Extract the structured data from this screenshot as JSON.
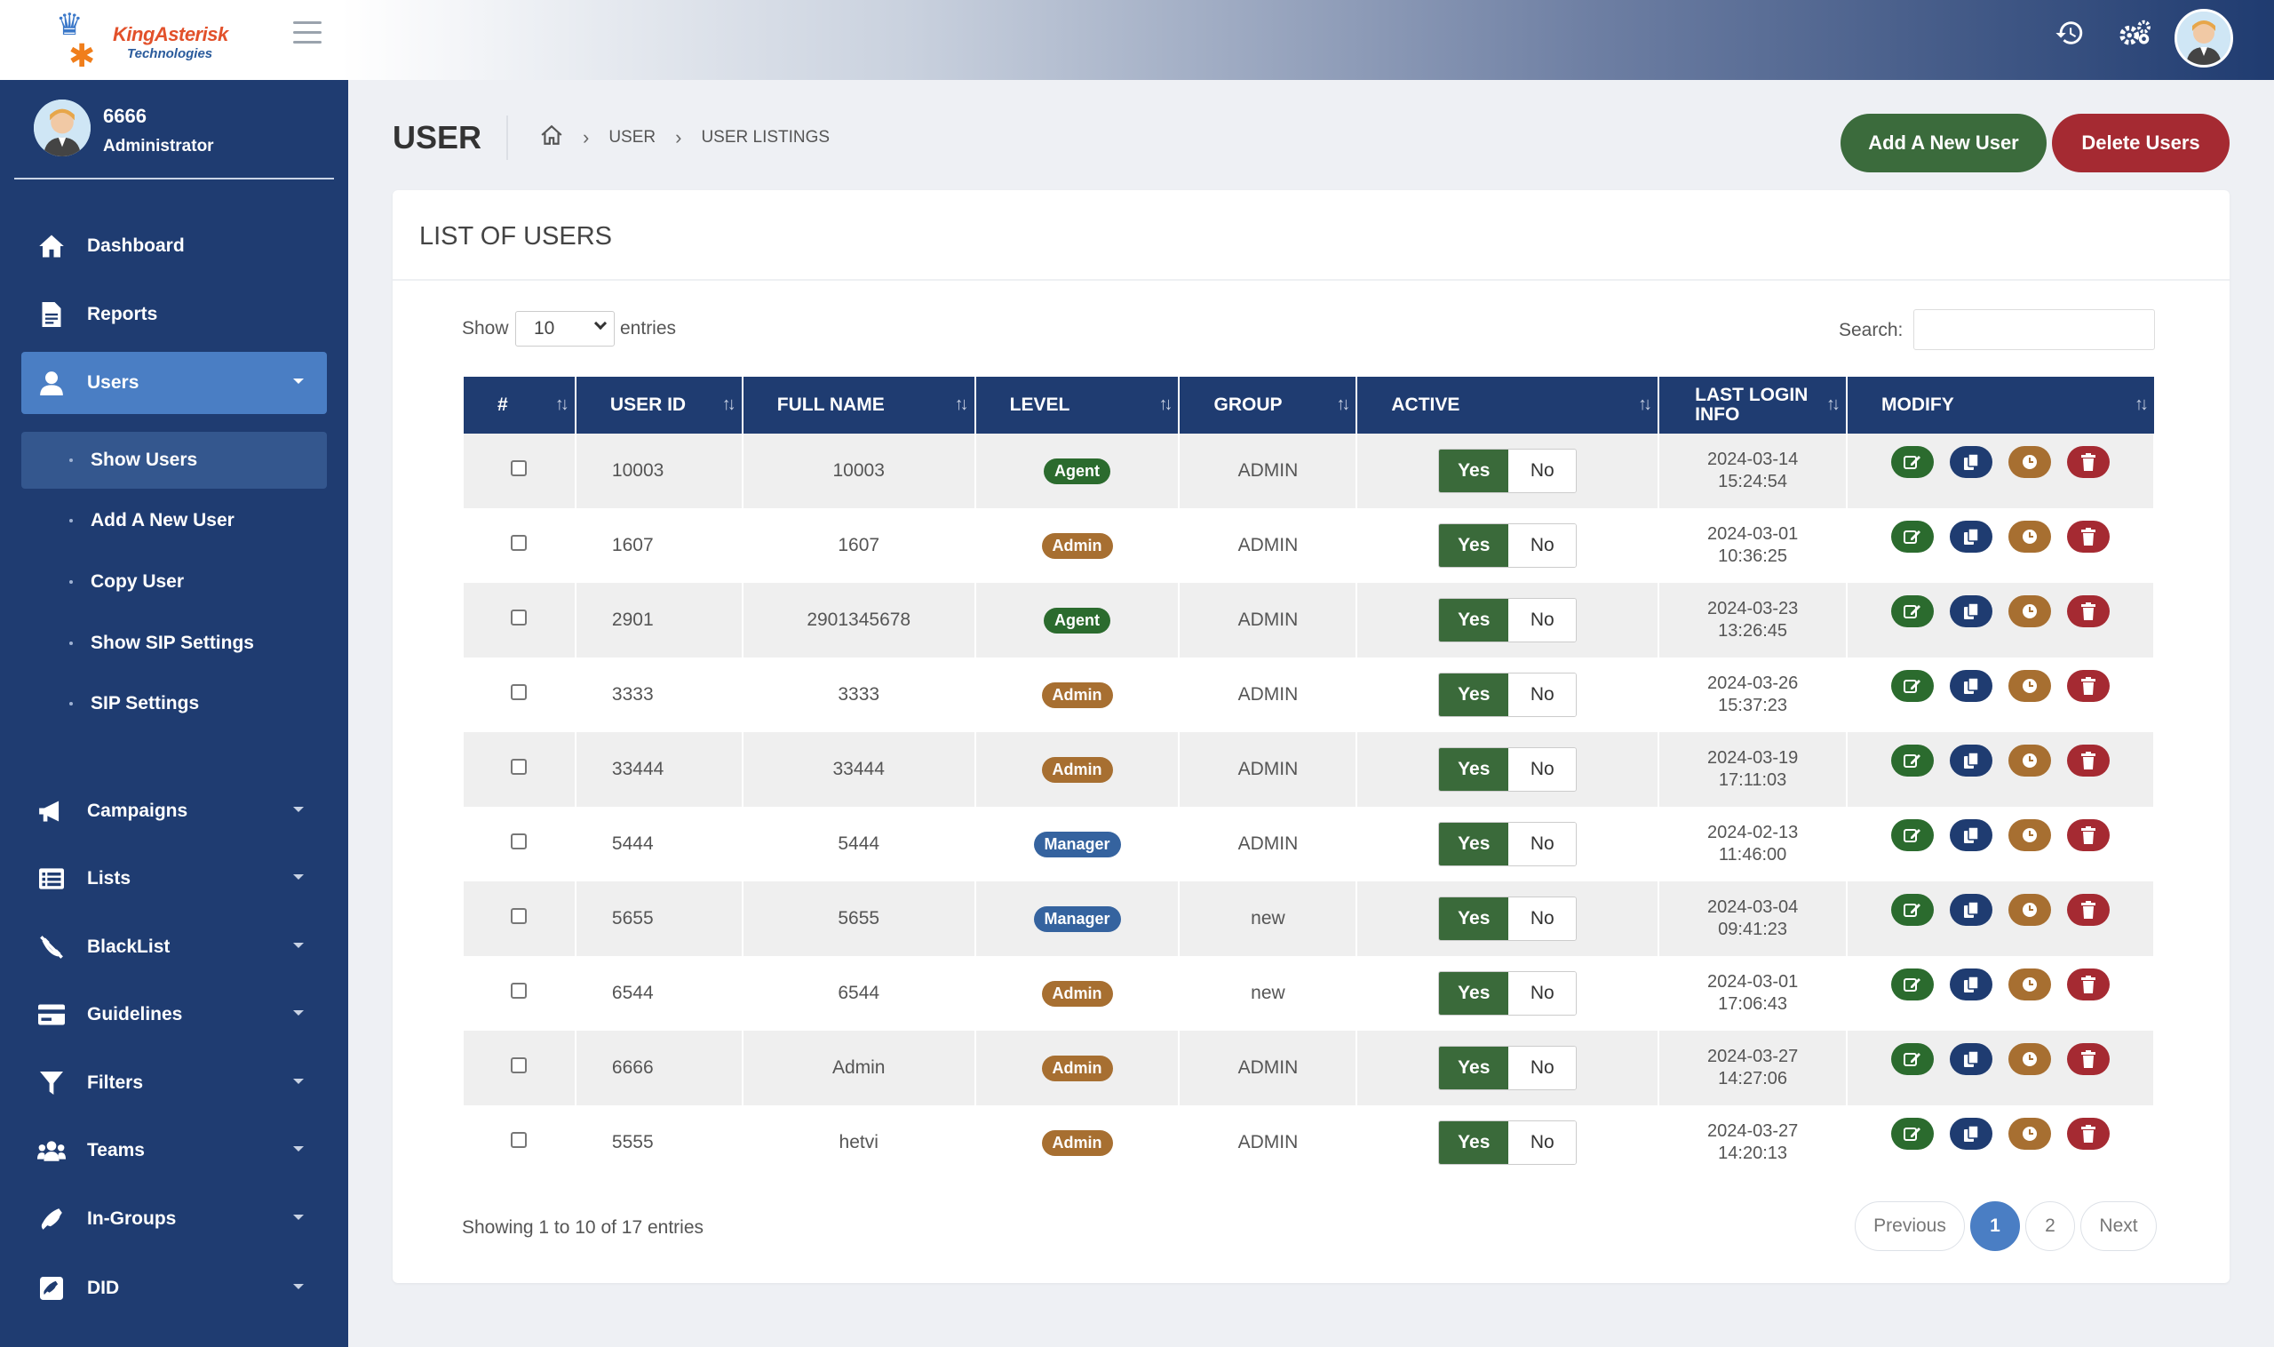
{
  "brand": {
    "name": "KingAsterisk",
    "sub": "Technologies"
  },
  "profile": {
    "name": "6666",
    "role": "Administrator"
  },
  "nav": {
    "dashboard": "Dashboard",
    "reports": "Reports",
    "users": "Users",
    "campaigns": "Campaigns",
    "lists": "Lists",
    "blacklist": "BlackList",
    "guidelines": "Guidelines",
    "filters": "Filters",
    "teams": "Teams",
    "ingroups": "In-Groups",
    "did": "DID"
  },
  "subnav": {
    "show_users": "Show Users",
    "add_user": "Add A New User",
    "copy_user": "Copy User",
    "show_sip": "Show SIP Settings",
    "sip_settings": "SIP Settings"
  },
  "header": {
    "title": "USER",
    "crumb1": "USER",
    "crumb2": "USER LISTINGS"
  },
  "buttons": {
    "add": "Add A New User",
    "delete": "Delete Users"
  },
  "card": {
    "title": "LIST OF USERS"
  },
  "controls": {
    "show": "Show",
    "entries_value": "10",
    "entries": "entries",
    "search": "Search:"
  },
  "table": {
    "headers": {
      "num": "#",
      "user_id": "USER ID",
      "full_name": "FULL NAME",
      "level": "LEVEL",
      "group": "GROUP",
      "active": "ACTIVE",
      "last_login_1": "LAST LOGIN",
      "last_login_2": "INFO",
      "modify": "MODIFY"
    },
    "yes": "Yes",
    "no": "No",
    "rows": [
      {
        "user_id": "10003",
        "full_name": "10003",
        "level": "Agent",
        "group": "ADMIN",
        "date": "2024-03-14",
        "time": "15:24:54"
      },
      {
        "user_id": "1607",
        "full_name": "1607",
        "level": "Admin",
        "group": "ADMIN",
        "date": "2024-03-01",
        "time": "10:36:25"
      },
      {
        "user_id": "2901",
        "full_name": "2901345678",
        "level": "Agent",
        "group": "ADMIN",
        "date": "2024-03-23",
        "time": "13:26:45"
      },
      {
        "user_id": "3333",
        "full_name": "3333",
        "level": "Admin",
        "group": "ADMIN",
        "date": "2024-03-26",
        "time": "15:37:23"
      },
      {
        "user_id": "33444",
        "full_name": "33444",
        "level": "Admin",
        "group": "ADMIN",
        "date": "2024-03-19",
        "time": "17:11:03"
      },
      {
        "user_id": "5444",
        "full_name": "5444",
        "level": "Manager",
        "group": "ADMIN",
        "date": "2024-02-13",
        "time": "11:46:00"
      },
      {
        "user_id": "5655",
        "full_name": "5655",
        "level": "Manager",
        "group": "new",
        "date": "2024-03-04",
        "time": "09:41:23"
      },
      {
        "user_id": "6544",
        "full_name": "6544",
        "level": "Admin",
        "group": "new",
        "date": "2024-03-01",
        "time": "17:06:43"
      },
      {
        "user_id": "6666",
        "full_name": "Admin",
        "level": "Admin",
        "group": "ADMIN",
        "date": "2024-03-27",
        "time": "14:27:06"
      },
      {
        "user_id": "5555",
        "full_name": "hetvi",
        "level": "Admin",
        "group": "ADMIN",
        "date": "2024-03-27",
        "time": "14:20:13"
      }
    ]
  },
  "footer": {
    "showing": "Showing 1 to 10 of 17 entries",
    "previous": "Previous",
    "page1": "1",
    "page2": "2",
    "next": "Next"
  },
  "colors": {
    "sidebar": "#1f3c71",
    "active": "#4a7ec4",
    "green": "#3b6b3c",
    "red": "#a52a32",
    "brown": "#a76f31"
  }
}
